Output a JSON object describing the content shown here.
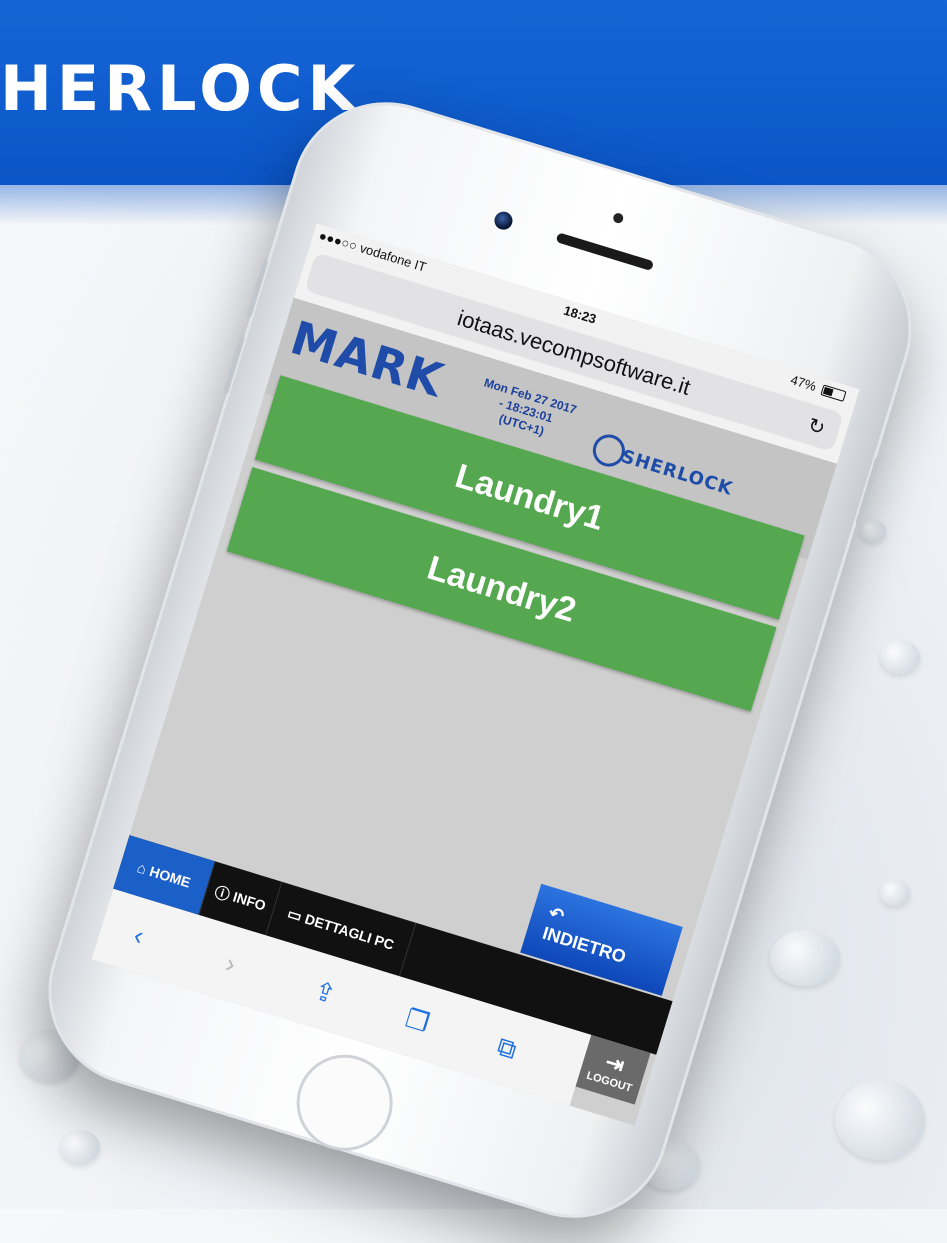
{
  "banner": {
    "title": "HERLOCK"
  },
  "status_bar": {
    "carrier": "●●●○○ vodafone IT",
    "time": "18:23",
    "battery": "47%"
  },
  "browser": {
    "url": "iotaas.vecompsoftware.it"
  },
  "app_header": {
    "logo": "MARK",
    "datetime_line1": "Mon Feb 27 2017",
    "datetime_line2": "- 18:23:01",
    "datetime_line3": "(UTC+1)",
    "brand": "SHERLOCK"
  },
  "devices": [
    {
      "label": "Laundry1"
    },
    {
      "label": "Laundry2"
    }
  ],
  "nav": {
    "home": "HOME",
    "info": "INFO",
    "details": "DETTAGLI PC",
    "back": "INDIETRO",
    "logout": "LOGOUT"
  },
  "colors": {
    "banner_blue": "#0b56c8",
    "device_green": "#55a84f",
    "nav_active_blue": "#1b5fc9",
    "brand_blue": "#1f4ca8"
  },
  "icons": {
    "home": "home-icon",
    "info": "info-icon",
    "details": "monitor-icon",
    "back": "back-arrow-icon",
    "logout": "logout-icon",
    "reload": "reload-icon",
    "safari": [
      "back-chevron-icon",
      "forward-chevron-icon",
      "share-icon",
      "bookmarks-icon",
      "tabs-icon"
    ]
  }
}
